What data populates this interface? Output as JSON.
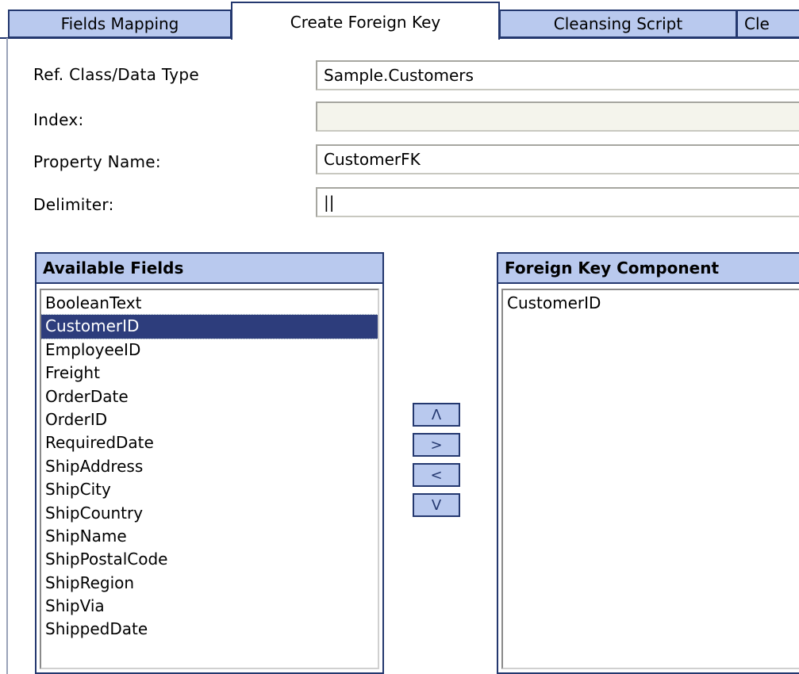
{
  "tabs": [
    {
      "label": "Fields Mapping",
      "active": false
    },
    {
      "label": "Create Foreign Key",
      "active": true
    },
    {
      "label": "Cleansing Script",
      "active": false
    },
    {
      "label": "Cle",
      "active": false
    }
  ],
  "form": {
    "ref_class": {
      "label": "Ref. Class/Data Type",
      "value": "Sample.Customers"
    },
    "index": {
      "label": "Index:",
      "value": ""
    },
    "property_name": {
      "label": "Property Name:",
      "value": "CustomerFK"
    },
    "delimiter": {
      "label": "Delimiter:",
      "value": "||"
    }
  },
  "available_fields": {
    "title": "Available Fields",
    "items": [
      "BooleanText",
      "CustomerID",
      "EmployeeID",
      "Freight",
      "OrderDate",
      "OrderID",
      "RequiredDate",
      "ShipAddress",
      "ShipCity",
      "ShipCountry",
      "ShipName",
      "ShipPostalCode",
      "ShipRegion",
      "ShipVia",
      "ShippedDate"
    ],
    "selected": "CustomerID"
  },
  "foreign_key_component": {
    "title": "Foreign Key Component",
    "items": [
      "CustomerID"
    ]
  },
  "buttons": {
    "move_up": "Λ",
    "add": ">",
    "remove": "<",
    "move_down": "V"
  },
  "colors": {
    "tab_bg": "#b9c9ee",
    "border": "#24386f",
    "selection": "#2d3d7c"
  }
}
